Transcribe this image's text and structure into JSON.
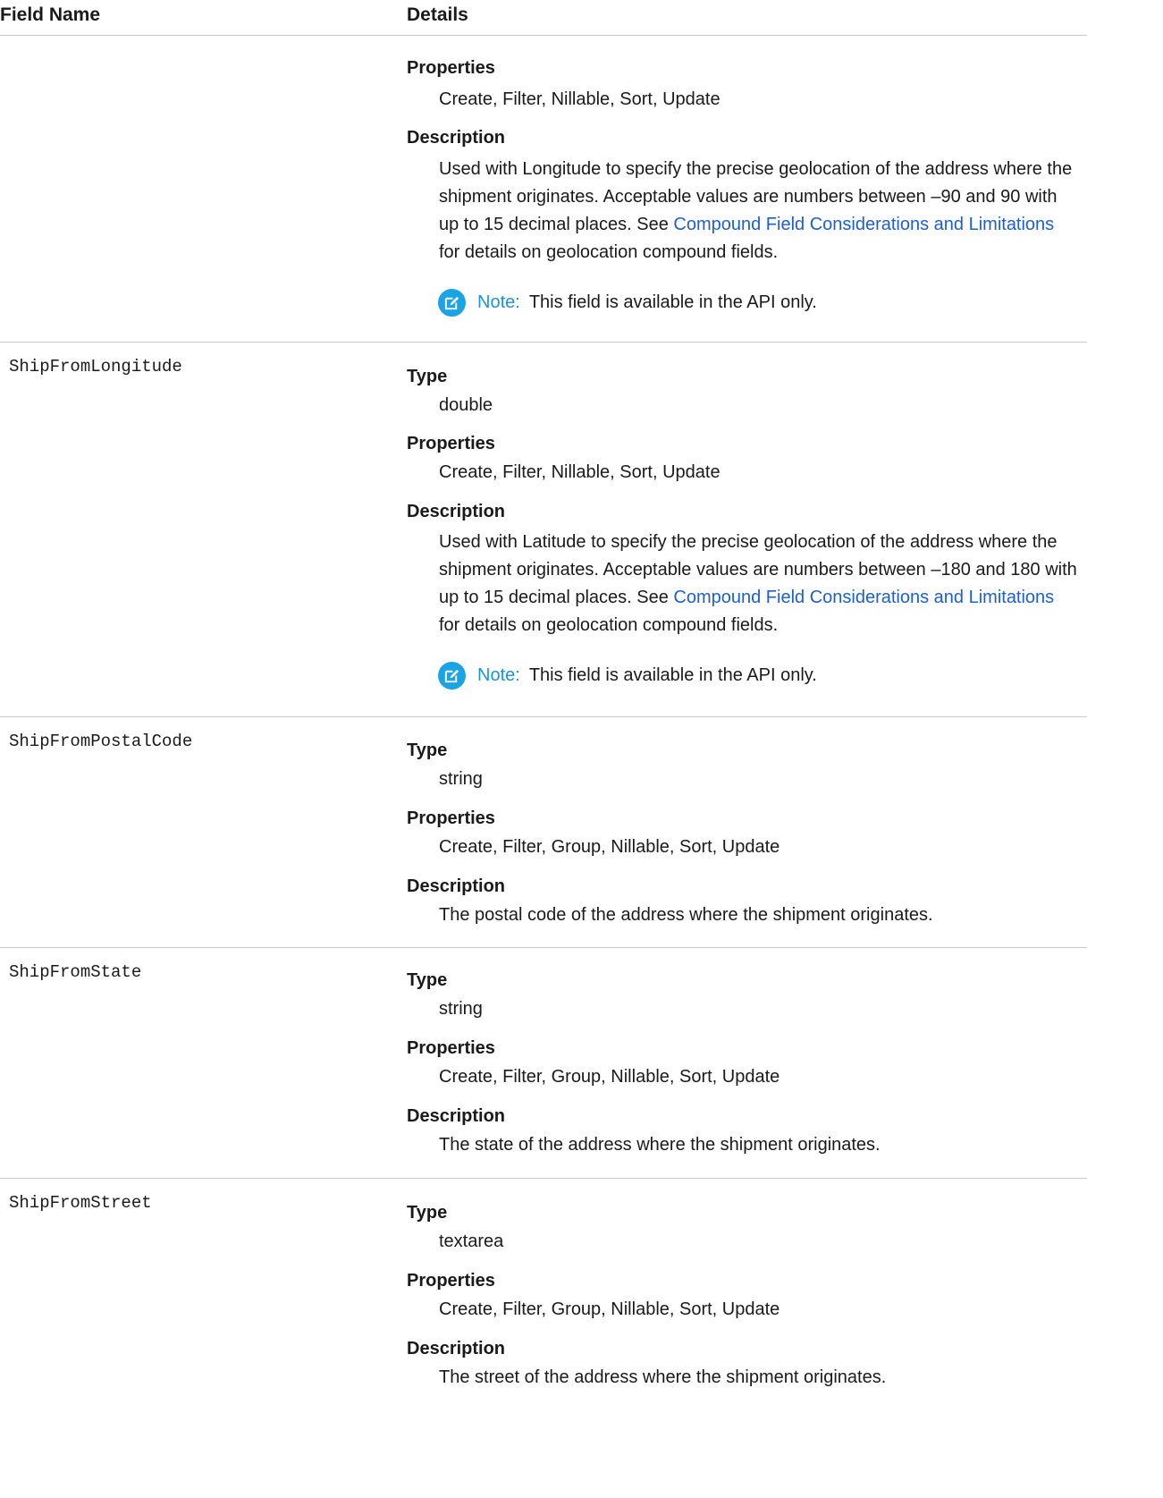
{
  "header": {
    "field_name": "Field Name",
    "details": "Details"
  },
  "labels": {
    "type": "Type",
    "properties": "Properties",
    "description": "Description"
  },
  "note": {
    "label": "Note:",
    "text": "This field is available in the API only.",
    "icon": "edit-note-icon"
  },
  "rows": [
    {
      "field": "",
      "properties": "Create, Filter, Nillable, Sort, Update",
      "description_lines": [
        "Used with Longitude to specify the precise geolocation of the address where the",
        "shipment originates. Acceptable values are numbers between –90 and 90 with",
        "up to 15 decimal places. See ",
        "for details on geolocation compound fields."
      ],
      "link": "Compound Field Considerations and Limitations"
    },
    {
      "field": "ShipFromLongitude",
      "type": "double",
      "properties": "Create, Filter, Nillable, Sort, Update",
      "description_lines": [
        "Used with Latitude to specify the precise geolocation of the address where the",
        "shipment originates. Acceptable values are numbers between –180 and 180 with",
        "up to 15 decimal places. See ",
        "for details on geolocation compound fields."
      ],
      "link": "Compound Field Considerations and Limitations"
    },
    {
      "field": "ShipFromPostalCode",
      "type": "string",
      "properties": "Create, Filter, Group, Nillable, Sort, Update",
      "description": "The postal code of the address where the shipment originates."
    },
    {
      "field": "ShipFromState",
      "type": "string",
      "properties": "Create, Filter, Group, Nillable, Sort, Update",
      "description": "The state of the address where the shipment originates."
    },
    {
      "field": "ShipFromStreet",
      "type": "textarea",
      "properties": "Create, Filter, Group, Nillable, Sort, Update",
      "description": "The street of the address where the shipment originates."
    }
  ],
  "colors": {
    "link": "#1b5fd6",
    "note_icon": "#1aa4e5",
    "divider": "#c9c9c9"
  }
}
